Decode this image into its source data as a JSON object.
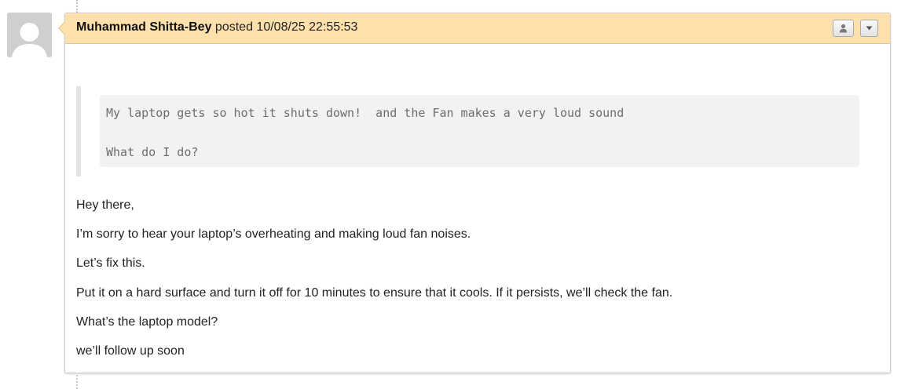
{
  "post": {
    "author": "Muhammad Shitta-Bey",
    "posted_label": "posted",
    "timestamp": "10/08/25 22:55:53",
    "quoted_lines": [
      "My laptop gets so hot it shuts down!  and the Fan makes a very loud sound",
      "What do I do?"
    ],
    "reply_paragraphs": [
      "Hey there,",
      "I’m sorry to hear your laptop’s overheating and making loud fan noises.",
      "Let’s fix this.",
      "Put it on a hard surface and turn it off for 10 minutes to ensure that it cools. If it persists, we’ll check the fan.",
      "What’s the laptop model?",
      "we’ll follow up soon"
    ]
  },
  "icons": {
    "avatar": "default-user-avatar-icon",
    "user_button": "person-icon",
    "menu_button": "caret-down-icon"
  },
  "colors": {
    "header_background": "#fde0ac",
    "header_border": "#e2c58f",
    "quote_background": "#f2f2f2",
    "quote_bar": "#e4e4e4",
    "avatar_background": "#cfcfcf"
  }
}
